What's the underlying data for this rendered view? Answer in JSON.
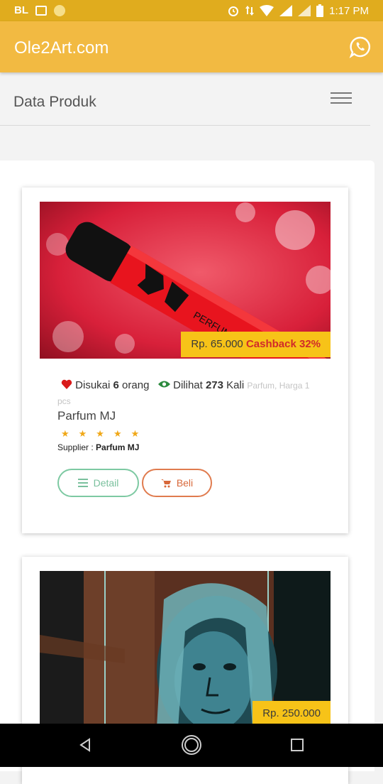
{
  "status_bar": {
    "left_text": "BL",
    "time": "1:17 PM"
  },
  "app_bar": {
    "brand": "Ole2Art.com",
    "whatsapp_icon": "whatsapp-icon"
  },
  "page": {
    "title": "Data Produk"
  },
  "products": [
    {
      "price": "Rp. 65.000",
      "cashback": "Cashback 32%",
      "likes_label": "Disukai",
      "likes": "6",
      "likes_unit": "orang",
      "views_label": "Dilihat",
      "views": "273",
      "views_unit": "Kali",
      "category": "Parfum, Harga 1 pcs",
      "name": "Parfum MJ",
      "rating": 5,
      "stars": "★★★★★",
      "supplier_label": "Supplier :",
      "supplier": "Parfum MJ",
      "detail_label": "Detail",
      "buy_label": "Beli"
    },
    {
      "price": "Rp. 250.000"
    }
  ],
  "colors": {
    "status_bar": "#e0ac1e",
    "app_bar": "#f2ba42",
    "price_tag": "#f7c318",
    "cashback": "#d12a2a",
    "detail_border": "#7dc9a2",
    "buy_border": "#e07b4e"
  }
}
